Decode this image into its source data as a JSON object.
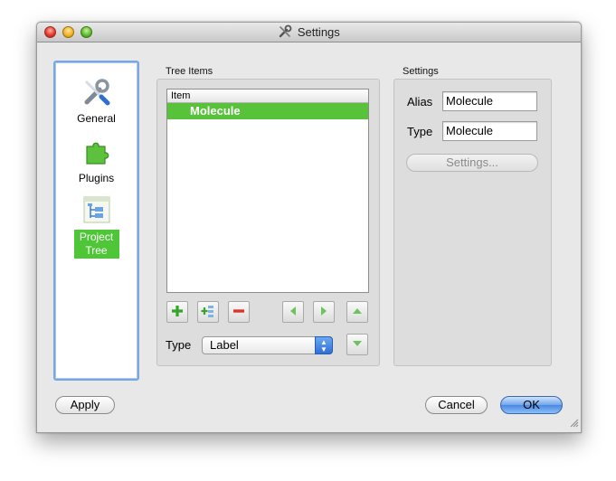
{
  "window": {
    "title": "Settings"
  },
  "sidebar": {
    "items": [
      {
        "label": "General",
        "icon": "wrench-screwdriver-icon"
      },
      {
        "label": "Plugins",
        "icon": "puzzle-piece-icon"
      },
      {
        "label": "Project Tree",
        "icon": "project-tree-icon",
        "selected": true
      }
    ]
  },
  "tree_items": {
    "title": "Tree Items",
    "column_header": "Item",
    "rows": [
      "Molecule"
    ],
    "type_label": "Type",
    "type_value": "Label"
  },
  "settings": {
    "title": "Settings",
    "alias_label": "Alias",
    "alias_value": "Molecule",
    "type_label": "Type",
    "type_value": "Molecule",
    "settings_button": "Settings..."
  },
  "buttons": {
    "apply": "Apply",
    "cancel": "Cancel",
    "ok": "OK"
  },
  "colors": {
    "selection_green": "#59c23b",
    "default_button_blue": "#4a88e3",
    "sidebar_border": "#7ba7e0"
  }
}
